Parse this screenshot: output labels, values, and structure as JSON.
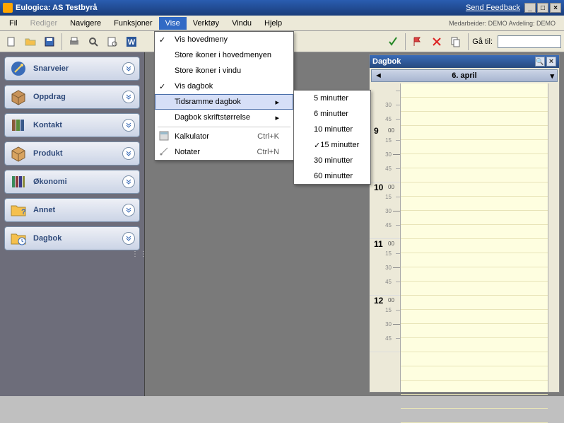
{
  "title": "Eulogica: AS Testbyrå",
  "feedback_link": "Send Feedback",
  "menubar": {
    "items": [
      "Fil",
      "Rediger",
      "Navigere",
      "Funksjoner",
      "Vise",
      "Verktøy",
      "Vindu",
      "Hjelp"
    ],
    "status": "Medarbeider: DEMO   Avdeling: DEMO"
  },
  "toolbar": {
    "go_label": "Gå til:",
    "go_value": ""
  },
  "sidebar": {
    "items": [
      {
        "label": "Snarveier",
        "icon": "wand"
      },
      {
        "label": "Oppdrag",
        "icon": "box"
      },
      {
        "label": "Kontakt",
        "icon": "books"
      },
      {
        "label": "Produkt",
        "icon": "box2"
      },
      {
        "label": "Økonomi",
        "icon": "books2"
      },
      {
        "label": "Annet",
        "icon": "folder-q"
      },
      {
        "label": "Dagbok",
        "icon": "folder-clock"
      }
    ]
  },
  "vise_menu": {
    "items": [
      {
        "label": "Vis hovedmeny",
        "checked": true
      },
      {
        "label": "Store ikoner i hovedmenyen"
      },
      {
        "label": "Store ikoner i vindu"
      },
      {
        "label": "Vis dagbok",
        "checked": true
      },
      {
        "label": "Tidsramme dagbok",
        "submenu": true,
        "highlight": true
      },
      {
        "label": "Dagbok skriftstørrelse",
        "submenu": true
      },
      {
        "sep": true
      },
      {
        "label": "Kalkulator",
        "shortcut": "Ctrl+K",
        "icon": "calc"
      },
      {
        "label": "Notater",
        "shortcut": "Ctrl+N",
        "icon": "note"
      }
    ]
  },
  "tidsramme_submenu": {
    "items": [
      {
        "label": "5 minutter"
      },
      {
        "label": "6 minutter"
      },
      {
        "label": "10 minutter"
      },
      {
        "label": "15 minutter",
        "checked": true
      },
      {
        "label": "30 minutter"
      },
      {
        "label": "60 minutter"
      }
    ]
  },
  "dagbok": {
    "title": "Dagbok",
    "date": "6. april",
    "hours": [
      9,
      10,
      11,
      12
    ]
  }
}
